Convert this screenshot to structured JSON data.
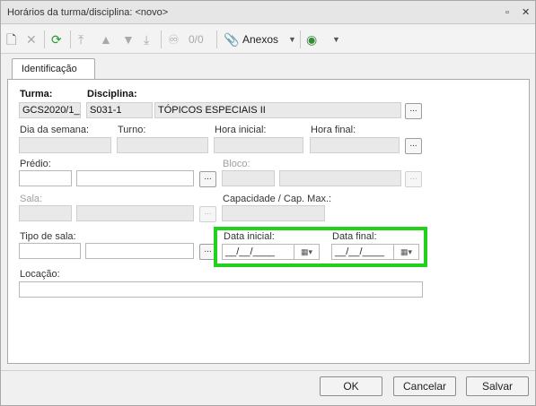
{
  "window": {
    "title": "Horários da turma/disciplina: <novo>"
  },
  "toolbar": {
    "record_counter": "0/0",
    "attachments_label": "Anexos"
  },
  "tabs": [
    {
      "label": "Identificação"
    }
  ],
  "form": {
    "turma": {
      "label": "Turma:",
      "value": "GCS2020/1_"
    },
    "disciplina": {
      "label": "Disciplina:",
      "code": "S031-1",
      "name": "TÓPICOS ESPECIAIS II"
    },
    "dia_semana": {
      "label": "Dia da semana:"
    },
    "turno": {
      "label": "Turno:"
    },
    "hora_inicial": {
      "label": "Hora inicial:"
    },
    "hora_final": {
      "label": "Hora final:"
    },
    "predio": {
      "label": "Prédio:"
    },
    "bloco": {
      "label": "Bloco:"
    },
    "sala": {
      "label": "Sala:"
    },
    "capacidade": {
      "label": "Capacidade / Cap. Max.:"
    },
    "tipo_sala": {
      "label": "Tipo de sala:"
    },
    "data_inicial": {
      "label": "Data inicial:",
      "value": "__/__/____"
    },
    "data_final": {
      "label": "Data final:",
      "value": "__/__/____"
    },
    "locacao": {
      "label": "Locação:"
    },
    "lookup_label": "..."
  },
  "buttons": {
    "ok": "OK",
    "cancel": "Cancelar",
    "save": "Salvar"
  }
}
